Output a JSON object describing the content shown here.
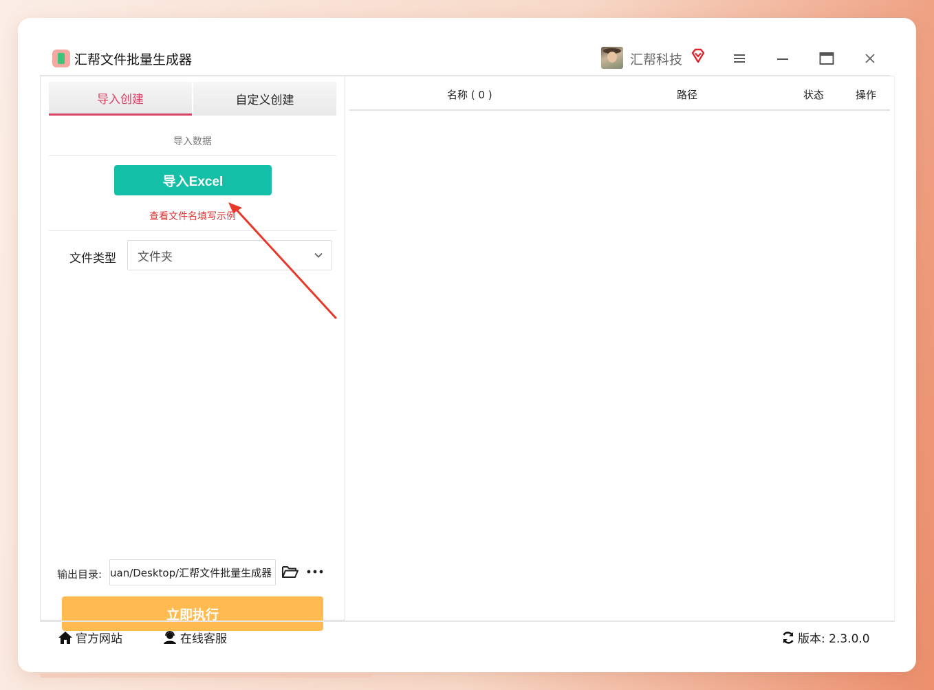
{
  "app": {
    "title": "汇帮文件批量生成器"
  },
  "user": {
    "name": "汇帮科技"
  },
  "tabs": [
    {
      "label": "导入创建",
      "active": true
    },
    {
      "label": "自定义创建",
      "active": false
    }
  ],
  "import": {
    "section_label": "导入数据",
    "button_label": "导入Excel",
    "example_link": "查看文件名填写示例"
  },
  "filetype": {
    "label": "文件类型",
    "value": "文件夹"
  },
  "output": {
    "label": "输出目录:",
    "value": "uan/Desktop/汇帮文件批量生成器"
  },
  "execute": {
    "label": "立即执行"
  },
  "table": {
    "columns": [
      "名称 ( 0 )",
      "路径",
      "状态",
      "操作"
    ],
    "rows": []
  },
  "footer": {
    "site": "官方网站",
    "service": "在线客服",
    "version": "版本:  2.3.0.0"
  },
  "colors": {
    "accent_tab": "#d94265",
    "import_button": "#13bfa6",
    "execute_button": "#ffbb4f",
    "link": "#dd3333",
    "annotation_arrow": "#e8382b"
  }
}
